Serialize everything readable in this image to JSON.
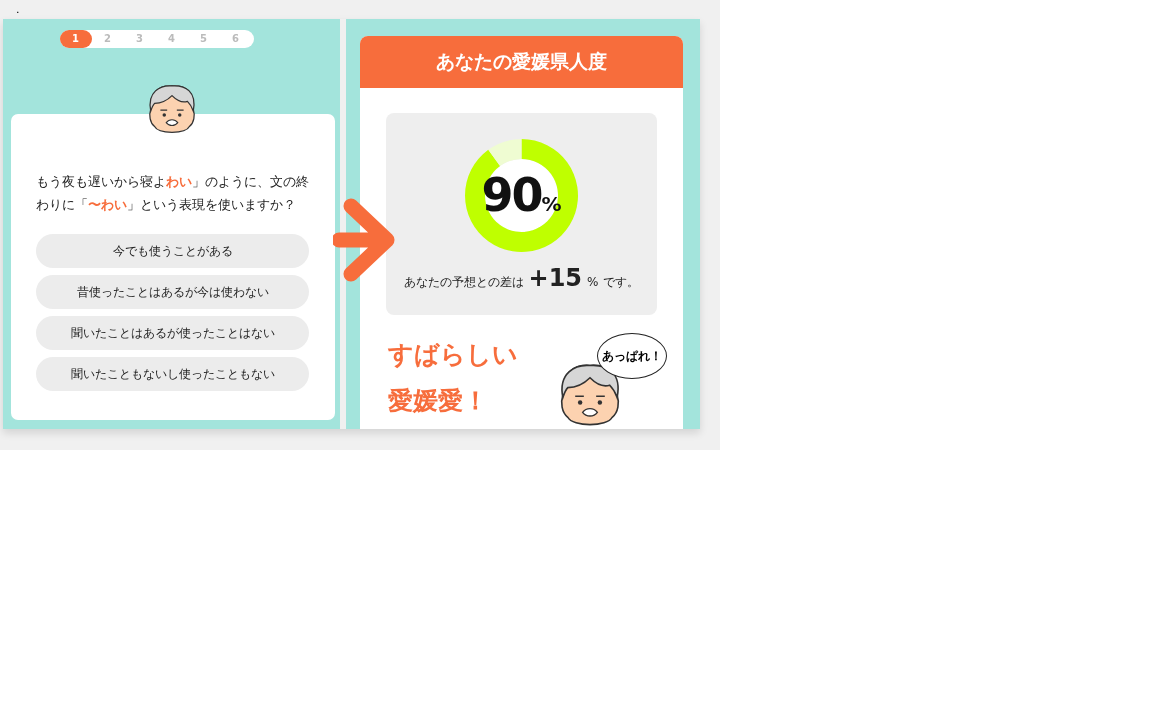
{
  "page_mark": ".",
  "steps": [
    {
      "label": "1",
      "selected": true
    },
    {
      "label": "2",
      "selected": false
    },
    {
      "label": "3",
      "selected": false
    },
    {
      "label": "4",
      "selected": false
    },
    {
      "label": "5",
      "selected": false
    },
    {
      "label": "6",
      "selected": false
    }
  ],
  "question": {
    "text": "もう夜も遅いから寝よ**わい**」のように、文の終わりに「**〜わい**」という表現を使いますか？"
  },
  "options": [
    {
      "label": "今でも使うことがある"
    },
    {
      "label": "昔使ったことはあるが今は使わない"
    },
    {
      "label": "聞いたことはあるが使ったことはない"
    },
    {
      "label": "聞いたこともないし使ったこともない"
    }
  ],
  "result": {
    "title": "あなたの愛媛県人度",
    "chart_data": {
      "type": "donut",
      "values": [
        90,
        10
      ]
    },
    "score": "90",
    "score_unit": "%",
    "difference_label": "あなたの予想との差は",
    "difference": "+15",
    "difference_unit": "%",
    "difference_suffix": "です。",
    "verdict_lines": [
      "すばらしい",
      "愛媛愛！"
    ],
    "bubble": "あっぱれ！"
  }
}
